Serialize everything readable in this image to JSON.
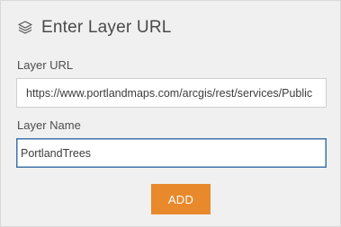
{
  "header": {
    "icon": "layers-icon",
    "title": "Enter Layer URL"
  },
  "form": {
    "url_label": "Layer URL",
    "url_value": "https://www.portlandmaps.com/arcgis/rest/services/Public",
    "name_label": "Layer Name",
    "name_value": "PortlandTrees",
    "add_button": "ADD"
  },
  "colors": {
    "panel_bg": "#f0f0f0",
    "accent": "#e8892b",
    "focus_border": "#3f73a8"
  }
}
